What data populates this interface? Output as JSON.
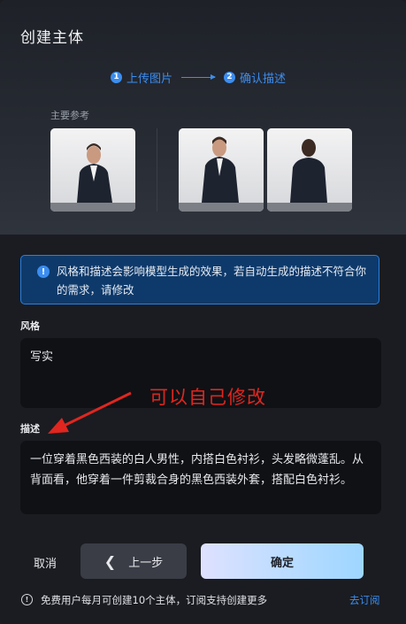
{
  "dialog": {
    "title": "创建主体",
    "steps": [
      {
        "num": "1",
        "label": "上传图片"
      },
      {
        "num": "2",
        "label": "确认描述"
      }
    ],
    "reference_label": "主要参考",
    "notice": {
      "icon": "info-icon",
      "text": "风格和描述会影响模型生成的效果，若自动生成的描述不符合你的需求，请修改"
    },
    "style": {
      "label": "风格",
      "value": "写实"
    },
    "description": {
      "label": "描述",
      "value": "一位穿着黑色西装的白人男性，内搭白色衬衫，头发略微蓬乱。从背面看，他穿着一件剪裁合身的黑色西装外套，搭配白色衬衫。"
    },
    "annotation": "可以自己修改",
    "buttons": {
      "cancel": "取消",
      "prev": "上一步",
      "confirm": "确定"
    },
    "footer": {
      "text": "免费用户每月可创建10个主体，订阅支持创建更多",
      "link": "去订阅"
    },
    "colors": {
      "accent": "#3b8df0",
      "annotation": "#e0261f"
    }
  }
}
